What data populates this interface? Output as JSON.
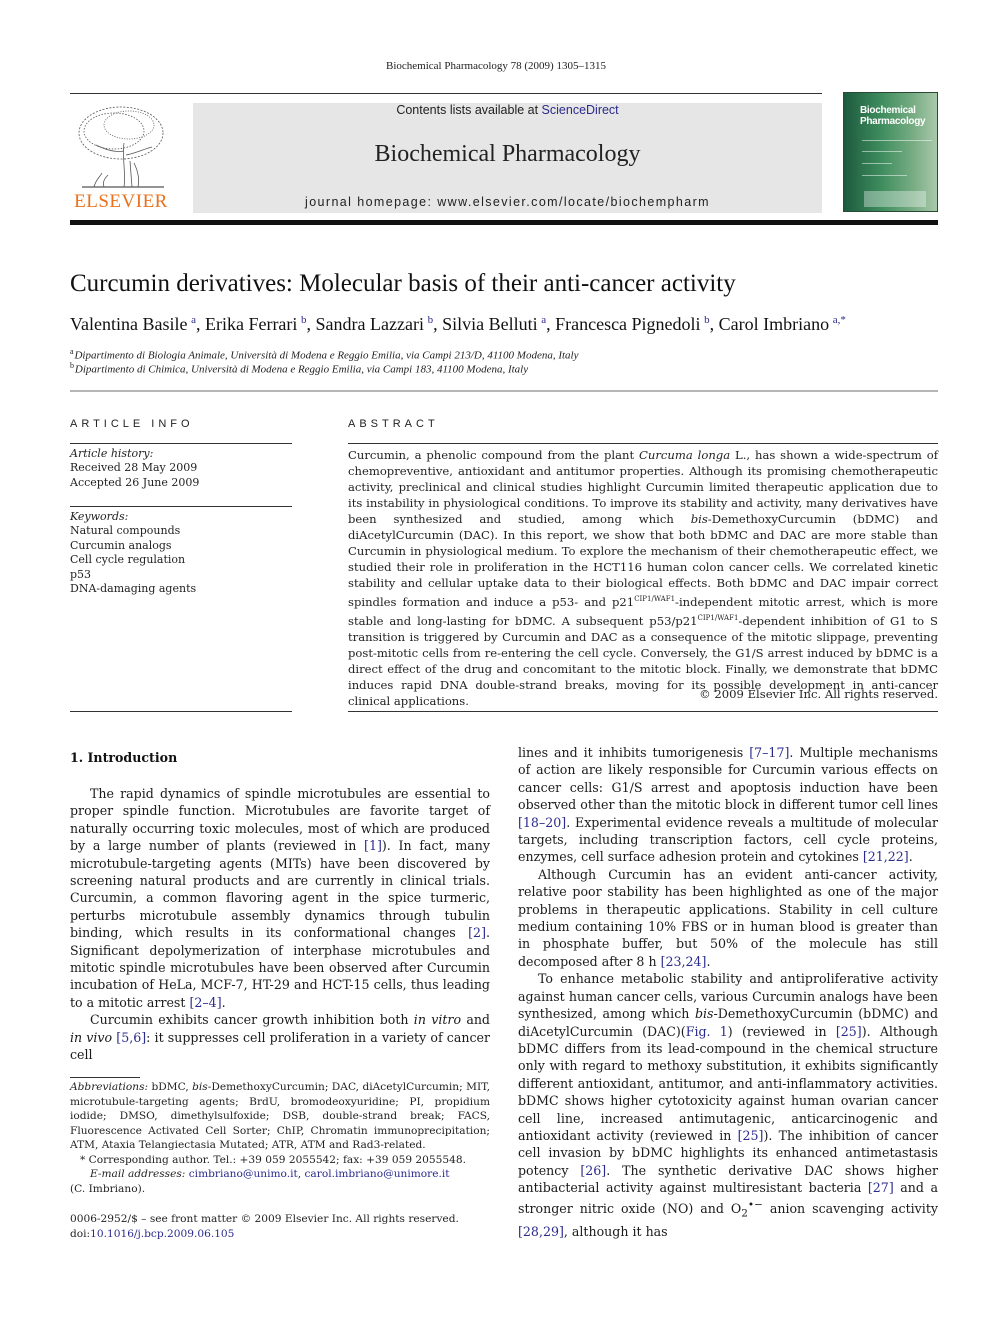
{
  "running_head": "Biochemical Pharmacology 78 (2009) 1305–1315",
  "masthead": {
    "publisher_logo_text": "ELSEVIER",
    "contents_prefix": "Contents lists available at ",
    "contents_link": "ScienceDirect",
    "journal_name": "Biochemical Pharmacology",
    "homepage_label": "journal homepage: ",
    "homepage_url": "www.elsevier.com/locate/biochempharm",
    "cover_title_line1": "Biochemical",
    "cover_title_line2": "Pharmacology",
    "colors": {
      "publisher_orange": "#e9711c",
      "masthead_gray": "#e6e6e6",
      "cover_green": "#3e8d5e",
      "link_blue": "#2a2a8c"
    }
  },
  "article": {
    "title": "Curcumin derivatives: Molecular basis of their anti-cancer activity",
    "authors": [
      {
        "name": "Valentina Basile",
        "aff": "a"
      },
      {
        "name": "Erika Ferrari",
        "aff": "b"
      },
      {
        "name": "Sandra Lazzari",
        "aff": "b"
      },
      {
        "name": "Silvia Belluti",
        "aff": "a"
      },
      {
        "name": "Francesca Pignedoli",
        "aff": "b"
      },
      {
        "name": "Carol Imbriano",
        "aff": "a,*"
      }
    ],
    "affiliations": [
      {
        "key": "a",
        "text": "Dipartimento di Biologia Animale, Università di Modena e Reggio Emilia, via Campi 213/D, 41100 Modena, Italy"
      },
      {
        "key": "b",
        "text": "Dipartimento di Chimica, Università di Modena e Reggio Emilia, via Campi 183, 41100 Modena, Italy"
      }
    ]
  },
  "article_info": {
    "heading": "ARTICLE INFO",
    "history_label": "Article history:",
    "received": "Received 28 May 2009",
    "accepted": "Accepted 26 June 2009",
    "keywords_label": "Keywords:",
    "keywords": [
      "Natural compounds",
      "Curcumin analogs",
      "Cell cycle regulation",
      "p53",
      "DNA-damaging agents"
    ]
  },
  "abstract": {
    "heading": "ABSTRACT",
    "s1a": "Curcumin, a phenolic compound from the plant ",
    "s1_italic": "Curcuma longa",
    "s1b": " L., has shown a wide-spectrum of chemopreventive, antioxidant and antitumor properties. Although its promising chemotherapeutic activity, preclinical and clinical studies highlight Curcumin limited therapeutic application due to its instability in physiological conditions. To improve its stability and activity, many derivatives have been synthesized and studied, among which ",
    "bis": "bis",
    "s2": "-DemethoxyCurcumin (bDMC) and diAcetylCurcumin (DAC). In this report, we show that both bDMC and DAC are more stable than Curcumin in physiological medium. To explore the mechanism of their chemotherapeutic effect, we studied their role in proliferation in the HCT116 human colon cancer cells. We correlated kinetic stability and cellular uptake data to their biological effects. Both bDMC and DAC impair correct spindles formation and induce a p53- and p21",
    "sup1": "CIP1/WAF1",
    "s3": "-independent mitotic arrest, which is more stable and long-lasting for bDMC. A subsequent p53/p21",
    "sup2": "CIP1/WAF1",
    "s4": "-dependent inhibition of G1 to S transition is triggered by Curcumin and DAC as a consequence of the mitotic slippage, preventing post-mitotic cells from re-entering the cell cycle. Conversely, the G1/S arrest induced by bDMC is a direct effect of the drug and concomitant to the mitotic block. Finally, we demonstrate that bDMC induces rapid DNA double-strand breaks, moving for its possible development in anti-cancer clinical applications.",
    "copyright": "© 2009 Elsevier Inc. All rights reserved."
  },
  "introduction": {
    "heading": "1.  Introduction",
    "p1": {
      "a": "The rapid dynamics of spindle microtubules are essential to proper spindle function. Microtubules are favorite target of naturally occurring toxic molecules, most of which are produced by a large number of plants (reviewed in ",
      "r1": "[1]",
      "b": "). In fact, many microtubule-targeting agents (MITs) have been discovered by screening natural products and are currently in clinical trials. Curcumin, a common flavoring agent in the spice turmeric, perturbs microtubule assembly dynamics through tubulin binding, which results in its conformational changes ",
      "r2": "[2]",
      "c": ". Significant depolymerization of interphase microtubules and mitotic spindle microtubules have been observed after Curcumin incubation of HeLa, MCF-7, HT-29 and HCT-15 cells, thus leading to a mitotic arrest ",
      "r3": "[2–4]",
      "d": "."
    },
    "p2": {
      "a": "Curcumin exhibits cancer growth inhibition both ",
      "i1": "in vitro",
      "b": " and ",
      "i2": "in vivo",
      "c": " ",
      "r1": "[5,6]",
      "d": ": it suppresses cell proliferation in a variety of cancer cell lines and it inhibits tumorigenesis ",
      "r2": "[7–17]",
      "e": ". Multiple mechanisms of action are likely responsible for Curcumin various effects on cancer cells: G1/S arrest and apoptosis induction have been observed other than the mitotic block in different tumor cell lines ",
      "r3": "[18–20]",
      "f": ". Experimental evidence reveals a multitude of molecular targets, including transcription factors, cell cycle proteins, enzymes, cell surface adhesion protein and cytokines ",
      "r4": "[21,22]",
      "g": "."
    },
    "p3": {
      "a": "Although Curcumin has an evident anti-cancer activity, relative poor stability has been highlighted as one of the major problems in therapeutic applications. Stability in cell culture medium containing 10% FBS or in human blood is greater than in phosphate buffer, but 50% of the molecule has still decomposed after 8 h ",
      "r1": "[23,24]",
      "b": "."
    },
    "p4": {
      "a": "To enhance metabolic stability and antiproliferative activity against human cancer cells, various Curcumin analogs have been synthesized, among which ",
      "i1": "bis",
      "b": "-DemethoxyCurcumin (bDMC) and diAcetylCurcumin (DAC)(",
      "fig": "Fig. 1",
      "c": ") (reviewed in ",
      "r1": "[25]",
      "d": "). Although bDMC differs from its lead-compound in the chemical structure only with regard to methoxy substitution, it exhibits significantly different antioxidant, antitumor, and anti-inflammatory activities. bDMC shows higher cytotoxicity against human ovarian cancer cell line, increased antimutagenic, anticarcinogenic and antioxidant activity (reviewed in ",
      "r2": "[25]",
      "e": "). The inhibition of cancer cell invasion by bDMC highlights its enhanced antimetastasis potency ",
      "r3": "[26]",
      "f": ". The synthetic derivative DAC shows higher antibacterial activity against multiresistant bacteria ",
      "r4": "[27]",
      "g": " and a stronger nitric oxide (NO) and O",
      "sub": "2",
      "sup": "•−",
      "h": " anion scavenging activity ",
      "r5": "[28,29]",
      "i": ", although it has"
    }
  },
  "footnotes": {
    "abbr_label": "Abbreviations:",
    "abbr_a": " bDMC, ",
    "abbr_bis": "bis",
    "abbr_b": "-DemethoxyCurcumin; DAC, diAcetylCurcumin; MIT, microtubule-targeting agents; BrdU, bromodeoxyuridine; PI, propidium iodide; DMSO, dimethylsulfoxide; DSB, double-strand break; FACS, Fluorescence Activated Cell Sorter; ChIP, Chromatin immunoprecipitation; ATM, Ataxia Telangiectasia Mutated; ATR, ATM and Rad3-related.",
    "corresponding": "* Corresponding author. Tel.: +39 059 2055542; fax: +39 059 2055548.",
    "email_label": "E-mail addresses:",
    "email1": "cimbriano@unimo.it",
    "email_sep": ", ",
    "email2": "carol.imbriano@unimore.it",
    "email_owner": "(C. Imbriano).",
    "front_matter": "0006-2952/$ – see front matter © 2009 Elsevier Inc. All rights reserved.",
    "doi_label": "doi:",
    "doi": "10.1016/j.bcp.2009.06.105"
  }
}
